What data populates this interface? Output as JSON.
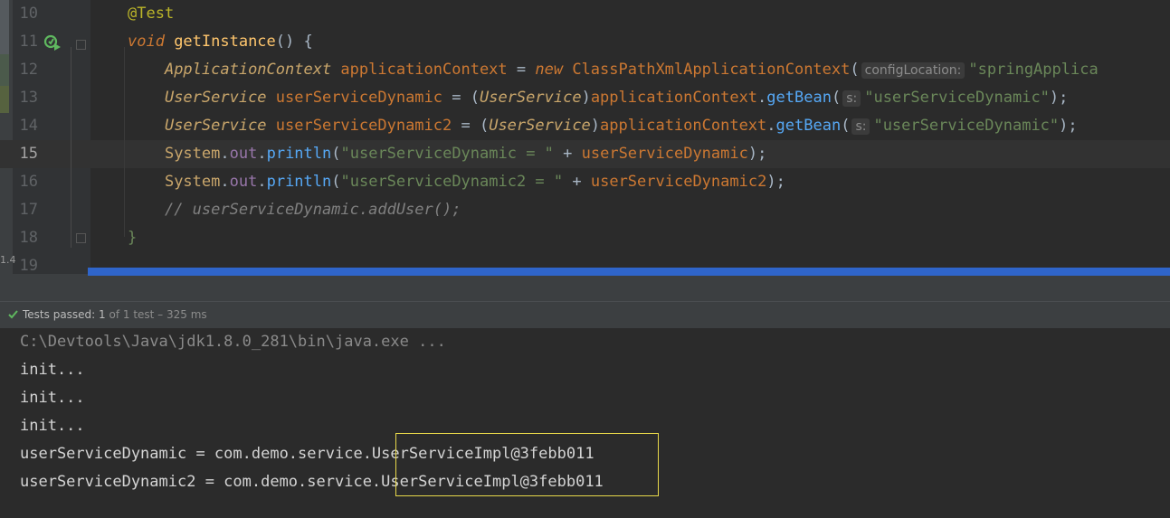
{
  "editor": {
    "lines": [
      {
        "num": "10",
        "parts": [
          {
            "t": "@Test",
            "c": "ann"
          }
        ]
      },
      {
        "num": "11",
        "parts": [
          {
            "t": "void ",
            "c": "kw"
          },
          {
            "t": "getInstance",
            "c": "mth"
          },
          {
            "t": "() {",
            "c": "cls"
          }
        ]
      },
      {
        "num": "12",
        "parts": [
          {
            "t": "    "
          },
          {
            "t": "ApplicationContext ",
            "c": "iface"
          },
          {
            "t": "applicationContext ",
            "c": "ty"
          },
          {
            "t": "= "
          },
          {
            "t": "new ",
            "c": "kw"
          },
          {
            "t": "ClassPathXmlApplicationContext",
            "c": "ty"
          },
          {
            "t": "("
          },
          {
            "hint": "configLocation:"
          },
          {
            "t": "\"springApplica",
            "c": "str"
          }
        ]
      },
      {
        "num": "13",
        "parts": [
          {
            "t": "    "
          },
          {
            "t": "UserService ",
            "c": "iface"
          },
          {
            "t": "userServiceDynamic ",
            "c": "ty"
          },
          {
            "t": "= ("
          },
          {
            "t": "UserService",
            "c": "iface"
          },
          {
            "t": ")"
          },
          {
            "t": "applicationContext",
            "c": "ty"
          },
          {
            "t": "."
          },
          {
            "t": "getBean",
            "c": "mcall"
          },
          {
            "t": "("
          },
          {
            "hint": "s:"
          },
          {
            "t": "\"userServiceDynamic\"",
            "c": "str"
          },
          {
            "t": ");"
          }
        ]
      },
      {
        "num": "14",
        "parts": [
          {
            "t": "    "
          },
          {
            "t": "UserService ",
            "c": "iface"
          },
          {
            "t": "userServiceDynamic2 ",
            "c": "ty"
          },
          {
            "t": "= ("
          },
          {
            "t": "UserService",
            "c": "iface"
          },
          {
            "t": ")"
          },
          {
            "t": "applicationContext",
            "c": "ty"
          },
          {
            "t": "."
          },
          {
            "t": "getBean",
            "c": "mcall"
          },
          {
            "t": "("
          },
          {
            "hint": "s:"
          },
          {
            "t": "\"userServiceDynamic\"",
            "c": "str"
          },
          {
            "t": ");"
          }
        ]
      },
      {
        "num": "15",
        "current": true,
        "parts": [
          {
            "t": "    "
          },
          {
            "t": "System",
            "c": "sysc"
          },
          {
            "t": "."
          },
          {
            "t": "out",
            "c": "fld"
          },
          {
            "t": "."
          },
          {
            "t": "println",
            "c": "mcall"
          },
          {
            "t": "("
          },
          {
            "t": "\"userServiceDynamic = \" ",
            "c": "str"
          },
          {
            "t": "+ "
          },
          {
            "t": "userServiceDynamic",
            "c": "ty"
          },
          {
            "t": ");"
          }
        ]
      },
      {
        "num": "16",
        "parts": [
          {
            "t": "    "
          },
          {
            "t": "System",
            "c": "sysc"
          },
          {
            "t": "."
          },
          {
            "t": "out",
            "c": "fld"
          },
          {
            "t": "."
          },
          {
            "t": "println",
            "c": "mcall"
          },
          {
            "t": "("
          },
          {
            "t": "\"userServiceDynamic2 = \" ",
            "c": "str"
          },
          {
            "t": "+ "
          },
          {
            "t": "userServiceDynamic2",
            "c": "ty"
          },
          {
            "t": ");"
          }
        ]
      },
      {
        "num": "17",
        "parts": [
          {
            "t": "    "
          },
          {
            "t": "// userServiceDynamic.addUser();",
            "c": "cmt"
          }
        ]
      },
      {
        "num": "18",
        "parts": [
          {
            "t": "}",
            "c": "str"
          }
        ]
      },
      {
        "num": "19",
        "parts": [
          {
            "t": ""
          }
        ]
      }
    ]
  },
  "left_crop_text": "1.4",
  "status": {
    "label": "Tests passed: ",
    "count": "1",
    "detail": " of 1 test – 325 ms"
  },
  "console": {
    "lines": [
      {
        "text": "C:\\Devtools\\Java\\jdk1.8.0_281\\bin\\java.exe ...",
        "dim": true
      },
      {
        "text": "init..."
      },
      {
        "text": "init..."
      },
      {
        "text": "init..."
      },
      {
        "text": "userServiceDynamic = com.demo.service.UserServiceImpl@3febb011"
      },
      {
        "text": "userServiceDynamic2 = com.demo.service.UserServiceImpl@3febb011"
      }
    ]
  },
  "colors": {
    "accent_blue": "#2f65ca",
    "highlight_box": "#e8d84a",
    "pass_green": "#5fb85f"
  }
}
